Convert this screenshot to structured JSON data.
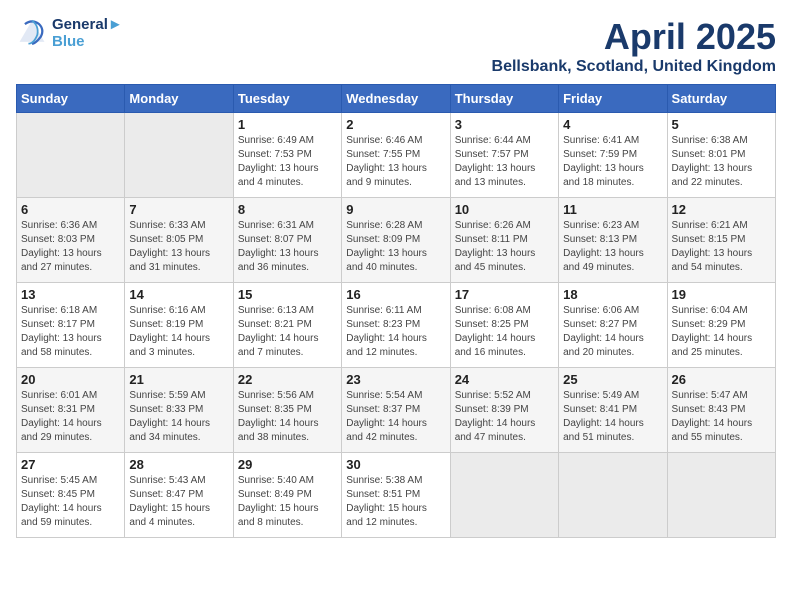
{
  "header": {
    "logo_line1": "General",
    "logo_line2": "Blue",
    "month": "April 2025",
    "location": "Bellsbank, Scotland, United Kingdom"
  },
  "weekdays": [
    "Sunday",
    "Monday",
    "Tuesday",
    "Wednesday",
    "Thursday",
    "Friday",
    "Saturday"
  ],
  "weeks": [
    [
      {
        "day": "",
        "info": ""
      },
      {
        "day": "",
        "info": ""
      },
      {
        "day": "1",
        "info": "Sunrise: 6:49 AM\nSunset: 7:53 PM\nDaylight: 13 hours\nand 4 minutes."
      },
      {
        "day": "2",
        "info": "Sunrise: 6:46 AM\nSunset: 7:55 PM\nDaylight: 13 hours\nand 9 minutes."
      },
      {
        "day": "3",
        "info": "Sunrise: 6:44 AM\nSunset: 7:57 PM\nDaylight: 13 hours\nand 13 minutes."
      },
      {
        "day": "4",
        "info": "Sunrise: 6:41 AM\nSunset: 7:59 PM\nDaylight: 13 hours\nand 18 minutes."
      },
      {
        "day": "5",
        "info": "Sunrise: 6:38 AM\nSunset: 8:01 PM\nDaylight: 13 hours\nand 22 minutes."
      }
    ],
    [
      {
        "day": "6",
        "info": "Sunrise: 6:36 AM\nSunset: 8:03 PM\nDaylight: 13 hours\nand 27 minutes."
      },
      {
        "day": "7",
        "info": "Sunrise: 6:33 AM\nSunset: 8:05 PM\nDaylight: 13 hours\nand 31 minutes."
      },
      {
        "day": "8",
        "info": "Sunrise: 6:31 AM\nSunset: 8:07 PM\nDaylight: 13 hours\nand 36 minutes."
      },
      {
        "day": "9",
        "info": "Sunrise: 6:28 AM\nSunset: 8:09 PM\nDaylight: 13 hours\nand 40 minutes."
      },
      {
        "day": "10",
        "info": "Sunrise: 6:26 AM\nSunset: 8:11 PM\nDaylight: 13 hours\nand 45 minutes."
      },
      {
        "day": "11",
        "info": "Sunrise: 6:23 AM\nSunset: 8:13 PM\nDaylight: 13 hours\nand 49 minutes."
      },
      {
        "day": "12",
        "info": "Sunrise: 6:21 AM\nSunset: 8:15 PM\nDaylight: 13 hours\nand 54 minutes."
      }
    ],
    [
      {
        "day": "13",
        "info": "Sunrise: 6:18 AM\nSunset: 8:17 PM\nDaylight: 13 hours\nand 58 minutes."
      },
      {
        "day": "14",
        "info": "Sunrise: 6:16 AM\nSunset: 8:19 PM\nDaylight: 14 hours\nand 3 minutes."
      },
      {
        "day": "15",
        "info": "Sunrise: 6:13 AM\nSunset: 8:21 PM\nDaylight: 14 hours\nand 7 minutes."
      },
      {
        "day": "16",
        "info": "Sunrise: 6:11 AM\nSunset: 8:23 PM\nDaylight: 14 hours\nand 12 minutes."
      },
      {
        "day": "17",
        "info": "Sunrise: 6:08 AM\nSunset: 8:25 PM\nDaylight: 14 hours\nand 16 minutes."
      },
      {
        "day": "18",
        "info": "Sunrise: 6:06 AM\nSunset: 8:27 PM\nDaylight: 14 hours\nand 20 minutes."
      },
      {
        "day": "19",
        "info": "Sunrise: 6:04 AM\nSunset: 8:29 PM\nDaylight: 14 hours\nand 25 minutes."
      }
    ],
    [
      {
        "day": "20",
        "info": "Sunrise: 6:01 AM\nSunset: 8:31 PM\nDaylight: 14 hours\nand 29 minutes."
      },
      {
        "day": "21",
        "info": "Sunrise: 5:59 AM\nSunset: 8:33 PM\nDaylight: 14 hours\nand 34 minutes."
      },
      {
        "day": "22",
        "info": "Sunrise: 5:56 AM\nSunset: 8:35 PM\nDaylight: 14 hours\nand 38 minutes."
      },
      {
        "day": "23",
        "info": "Sunrise: 5:54 AM\nSunset: 8:37 PM\nDaylight: 14 hours\nand 42 minutes."
      },
      {
        "day": "24",
        "info": "Sunrise: 5:52 AM\nSunset: 8:39 PM\nDaylight: 14 hours\nand 47 minutes."
      },
      {
        "day": "25",
        "info": "Sunrise: 5:49 AM\nSunset: 8:41 PM\nDaylight: 14 hours\nand 51 minutes."
      },
      {
        "day": "26",
        "info": "Sunrise: 5:47 AM\nSunset: 8:43 PM\nDaylight: 14 hours\nand 55 minutes."
      }
    ],
    [
      {
        "day": "27",
        "info": "Sunrise: 5:45 AM\nSunset: 8:45 PM\nDaylight: 14 hours\nand 59 minutes."
      },
      {
        "day": "28",
        "info": "Sunrise: 5:43 AM\nSunset: 8:47 PM\nDaylight: 15 hours\nand 4 minutes."
      },
      {
        "day": "29",
        "info": "Sunrise: 5:40 AM\nSunset: 8:49 PM\nDaylight: 15 hours\nand 8 minutes."
      },
      {
        "day": "30",
        "info": "Sunrise: 5:38 AM\nSunset: 8:51 PM\nDaylight: 15 hours\nand 12 minutes."
      },
      {
        "day": "",
        "info": ""
      },
      {
        "day": "",
        "info": ""
      },
      {
        "day": "",
        "info": ""
      }
    ]
  ]
}
